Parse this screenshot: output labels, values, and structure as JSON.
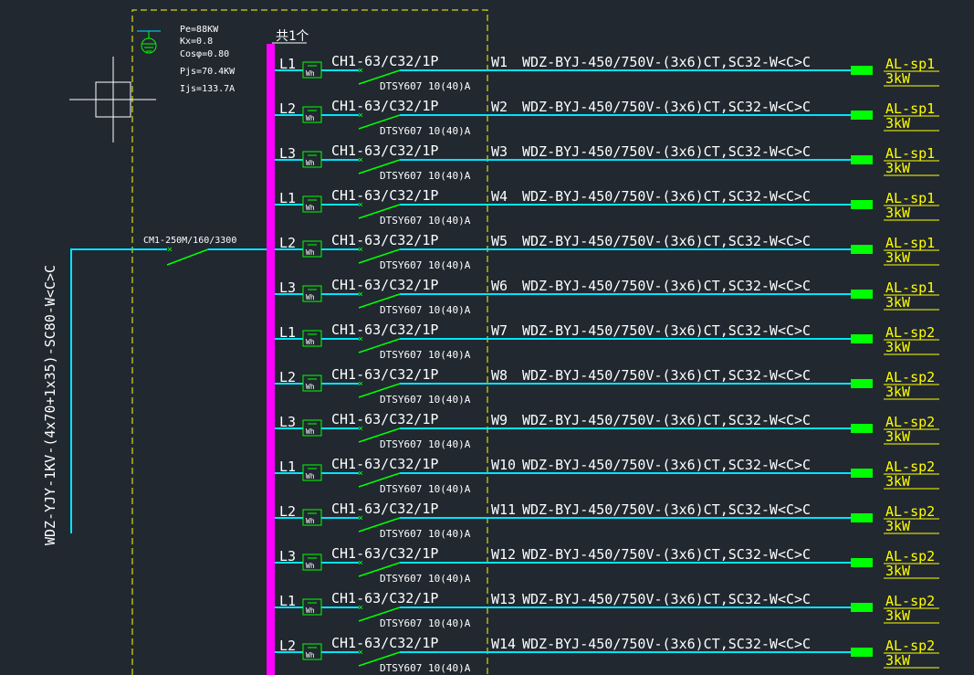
{
  "colors": {
    "background": "#212830",
    "feeder_line": "#00e5ff",
    "busbar": "#ff00ff",
    "breaker": "#00ff00",
    "frame": "#ffff00",
    "text": "#ffffff",
    "load_label": "#ffff00"
  },
  "icons": {
    "ground": "ground-symbol-icon",
    "crosshair": "crosshair-cursor-icon",
    "meter": "watt-hour-meter-icon",
    "breaker": "circuit-breaker-icon",
    "load": "load-block-icon"
  },
  "params": {
    "pe": "Pe=88KW",
    "kx": "Kx=0.8",
    "cos": "Cosφ=0.80",
    "pjs": "Pjs=70.4KW",
    "ijs": "Ijs=133.7A"
  },
  "incomer": {
    "cable": "WDZ-YJY-1KV-(4x70+1x35)-SC80-W<C>C",
    "breaker": "CM1-250M/160/3300"
  },
  "bus_label": "共1个",
  "circuits": [
    {
      "phase": "L1",
      "breaker": "CH1-63/C32/1P",
      "meter_label": "Wh",
      "meter": "DTSY607 10(40)A",
      "id": "W1",
      "cable": "WDZ-BYJ-450/750V-(3x6)CT,SC32-W<C>C",
      "load": "AL-sp1",
      "power": "3kW"
    },
    {
      "phase": "L2",
      "breaker": "CH1-63/C32/1P",
      "meter_label": "Wh",
      "meter": "DTSY607 10(40)A",
      "id": "W2",
      "cable": "WDZ-BYJ-450/750V-(3x6)CT,SC32-W<C>C",
      "load": "AL-sp1",
      "power": "3kW"
    },
    {
      "phase": "L3",
      "breaker": "CH1-63/C32/1P",
      "meter_label": "Wh",
      "meter": "DTSY607 10(40)A",
      "id": "W3",
      "cable": "WDZ-BYJ-450/750V-(3x6)CT,SC32-W<C>C",
      "load": "AL-sp1",
      "power": "3kW"
    },
    {
      "phase": "L1",
      "breaker": "CH1-63/C32/1P",
      "meter_label": "Wh",
      "meter": "DTSY607 10(40)A",
      "id": "W4",
      "cable": "WDZ-BYJ-450/750V-(3x6)CT,SC32-W<C>C",
      "load": "AL-sp1",
      "power": "3kW"
    },
    {
      "phase": "L2",
      "breaker": "CH1-63/C32/1P",
      "meter_label": "Wh",
      "meter": "DTSY607 10(40)A",
      "id": "W5",
      "cable": "WDZ-BYJ-450/750V-(3x6)CT,SC32-W<C>C",
      "load": "AL-sp1",
      "power": "3kW"
    },
    {
      "phase": "L3",
      "breaker": "CH1-63/C32/1P",
      "meter_label": "Wh",
      "meter": "DTSY607 10(40)A",
      "id": "W6",
      "cable": "WDZ-BYJ-450/750V-(3x6)CT,SC32-W<C>C",
      "load": "AL-sp1",
      "power": "3kW"
    },
    {
      "phase": "L1",
      "breaker": "CH1-63/C32/1P",
      "meter_label": "Wh",
      "meter": "DTSY607 10(40)A",
      "id": "W7",
      "cable": "WDZ-BYJ-450/750V-(3x6)CT,SC32-W<C>C",
      "load": "AL-sp2",
      "power": "3kW"
    },
    {
      "phase": "L2",
      "breaker": "CH1-63/C32/1P",
      "meter_label": "Wh",
      "meter": "DTSY607 10(40)A",
      "id": "W8",
      "cable": "WDZ-BYJ-450/750V-(3x6)CT,SC32-W<C>C",
      "load": "AL-sp2",
      "power": "3kW"
    },
    {
      "phase": "L3",
      "breaker": "CH1-63/C32/1P",
      "meter_label": "Wh",
      "meter": "DTSY607 10(40)A",
      "id": "W9",
      "cable": "WDZ-BYJ-450/750V-(3x6)CT,SC32-W<C>C",
      "load": "AL-sp2",
      "power": "3kW"
    },
    {
      "phase": "L1",
      "breaker": "CH1-63/C32/1P",
      "meter_label": "Wh",
      "meter": "DTSY607 10(40)A",
      "id": "W10",
      "cable": "WDZ-BYJ-450/750V-(3x6)CT,SC32-W<C>C",
      "load": "AL-sp2",
      "power": "3kW"
    },
    {
      "phase": "L2",
      "breaker": "CH1-63/C32/1P",
      "meter_label": "Wh",
      "meter": "DTSY607 10(40)A",
      "id": "W11",
      "cable": "WDZ-BYJ-450/750V-(3x6)CT,SC32-W<C>C",
      "load": "AL-sp2",
      "power": "3kW"
    },
    {
      "phase": "L3",
      "breaker": "CH1-63/C32/1P",
      "meter_label": "Wh",
      "meter": "DTSY607 10(40)A",
      "id": "W12",
      "cable": "WDZ-BYJ-450/750V-(3x6)CT,SC32-W<C>C",
      "load": "AL-sp2",
      "power": "3kW"
    },
    {
      "phase": "L1",
      "breaker": "CH1-63/C32/1P",
      "meter_label": "Wh",
      "meter": "DTSY607 10(40)A",
      "id": "W13",
      "cable": "WDZ-BYJ-450/750V-(3x6)CT,SC32-W<C>C",
      "load": "AL-sp2",
      "power": "3kW"
    },
    {
      "phase": "L2",
      "breaker": "CH1-63/C32/1P",
      "meter_label": "Wh",
      "meter": "DTSY607 10(40)A",
      "id": "W14",
      "cable": "WDZ-BYJ-450/750V-(3x6)CT,SC32-W<C>C",
      "load": "AL-sp2",
      "power": "3kW"
    }
  ]
}
